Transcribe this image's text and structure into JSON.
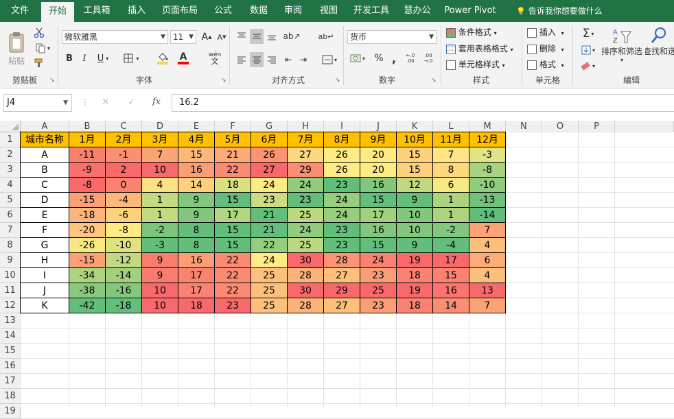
{
  "tabs": [
    {
      "label": "文件",
      "active": false
    },
    {
      "label": "开始",
      "active": true
    },
    {
      "label": "工具箱",
      "active": false
    },
    {
      "label": "插入",
      "active": false
    },
    {
      "label": "页面布局",
      "active": false
    },
    {
      "label": "公式",
      "active": false
    },
    {
      "label": "数据",
      "active": false
    },
    {
      "label": "审阅",
      "active": false
    },
    {
      "label": "视图",
      "active": false
    },
    {
      "label": "开发工具",
      "active": false
    },
    {
      "label": "慧办公",
      "active": false
    },
    {
      "label": "Power Pivot",
      "active": false
    }
  ],
  "tell_me": "告诉我你想要做什么",
  "ribbon": {
    "clipboard": {
      "paste": "粘贴",
      "label": "剪贴板"
    },
    "font": {
      "name": "微软雅黑",
      "size": "11",
      "bold": "B",
      "italic": "I",
      "underline": "U",
      "label": "字体",
      "font_color": "#ff0000",
      "fill_color": "#ffd24d",
      "grow": "A",
      "shrink": "A",
      "wen": "wén"
    },
    "alignment": {
      "label": "对齐方式"
    },
    "number": {
      "format": "货币",
      "percent": "%",
      "comma": ",",
      "label": "数字",
      "dec_inc": "←.0 .00",
      "dec_dec": ".00 →.0"
    },
    "styles": {
      "cond": "条件格式",
      "table": "套用表格格式",
      "cell": "单元格样式",
      "label": "样式"
    },
    "cells": {
      "insert": "插入",
      "delete": "删除",
      "format": "格式",
      "label": "单元格"
    },
    "editing": {
      "sort": "排序和筛选",
      "find": "查找和选",
      "label": "编辑"
    }
  },
  "formula_bar": {
    "name_box": "J4",
    "cancel": "✕",
    "enter": "✓",
    "fx": "fx",
    "value": "16.2"
  },
  "columns": [
    "A",
    "B",
    "C",
    "D",
    "E",
    "F",
    "G",
    "H",
    "I",
    "J",
    "K",
    "L",
    "M",
    "N",
    "O",
    "P"
  ],
  "rows": [
    "1",
    "2",
    "3",
    "4",
    "5",
    "6",
    "7",
    "8",
    "9",
    "10",
    "11",
    "12",
    "13",
    "14",
    "15",
    "16",
    "17",
    "18",
    "19"
  ],
  "table": {
    "header": [
      "城市名称",
      "1月",
      "2月",
      "3月",
      "4月",
      "5月",
      "6月",
      "7月",
      "8月",
      "9月",
      "10月",
      "11月",
      "12月"
    ],
    "header_color": "#ffc000",
    "scale_colors": {
      "low": "#63be7b",
      "mid": "#ffeb84",
      "high": "#f8696b"
    },
    "rows": [
      {
        "city": "A",
        "values": [
          -11,
          -1,
          7,
          15,
          21,
          26,
          27,
          26,
          20,
          15,
          7,
          -3
        ]
      },
      {
        "city": "B",
        "values": [
          -9,
          2,
          10,
          16,
          22,
          27,
          29,
          26,
          20,
          15,
          8,
          -8
        ]
      },
      {
        "city": "C",
        "values": [
          -8,
          0,
          4,
          14,
          18,
          24,
          24,
          23,
          16,
          12,
          6,
          -10
        ]
      },
      {
        "city": "D",
        "values": [
          -15,
          -4,
          1,
          9,
          15,
          23,
          23,
          24,
          15,
          9,
          1,
          -13
        ]
      },
      {
        "city": "E",
        "values": [
          -18,
          -6,
          1,
          9,
          17,
          21,
          25,
          24,
          17,
          10,
          1,
          -14
        ]
      },
      {
        "city": "F",
        "values": [
          -20,
          -8,
          -2,
          8,
          15,
          21,
          24,
          23,
          16,
          10,
          -2,
          7
        ]
      },
      {
        "city": "G",
        "values": [
          -26,
          -10,
          -3,
          8,
          15,
          22,
          25,
          23,
          15,
          9,
          -4,
          4
        ]
      },
      {
        "city": "H",
        "values": [
          -15,
          -12,
          9,
          16,
          22,
          24,
          30,
          28,
          24,
          19,
          17,
          6
        ]
      },
      {
        "city": "I",
        "values": [
          -34,
          -14,
          9,
          17,
          22,
          25,
          28,
          27,
          23,
          18,
          15,
          4
        ]
      },
      {
        "city": "J",
        "values": [
          -38,
          -16,
          10,
          17,
          22,
          25,
          30,
          29,
          25,
          19,
          16,
          13
        ]
      },
      {
        "city": "K",
        "values": [
          -42,
          -18,
          10,
          18,
          23,
          25,
          28,
          27,
          23,
          18,
          14,
          7
        ]
      }
    ]
  }
}
